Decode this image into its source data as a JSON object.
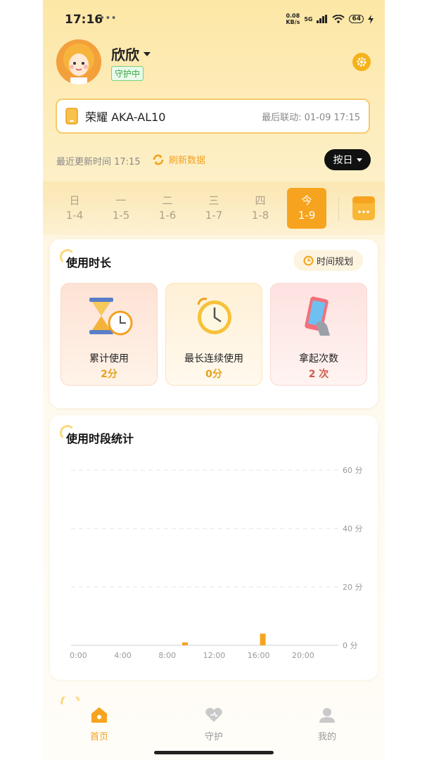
{
  "status_bar": {
    "time": "17:16",
    "extra": "•••",
    "net_speed_value": "0.08",
    "net_speed_unit": "KB/s",
    "network": "5G",
    "battery": "64"
  },
  "profile": {
    "name": "欣欣",
    "badge": "守护中",
    "settings_icon": "gear-icon"
  },
  "device": {
    "name": "荣耀 AKA-AL10",
    "last_sync": "最后联动: 01-09 17:15"
  },
  "update": {
    "text": "最近更新时间 17:15",
    "refresh_label": "刷新数据",
    "mode_label": "按日"
  },
  "days": [
    {
      "weekday": "日",
      "date": "1-4"
    },
    {
      "weekday": "一",
      "date": "1-5"
    },
    {
      "weekday": "二",
      "date": "1-6"
    },
    {
      "weekday": "三",
      "date": "1-7"
    },
    {
      "weekday": "四",
      "date": "1-8"
    },
    {
      "weekday": "今",
      "date": "1-9",
      "active": true
    }
  ],
  "usage": {
    "title": "使用时长",
    "plan_label": "时间规划",
    "tiles": [
      {
        "label": "累计使用",
        "value": "2分",
        "color": "#e3a21c"
      },
      {
        "label": "最长连续使用",
        "value": "0分",
        "color": "#e3a21c"
      },
      {
        "label": "拿起次数",
        "value": "2 次",
        "color": "#d25a4a"
      }
    ]
  },
  "chart_section": {
    "title": "使用时段统计"
  },
  "chart_data": {
    "type": "bar",
    "x_ticks": [
      "0:00",
      "4:00",
      "8:00",
      "12:00",
      "16:00",
      "20:00"
    ],
    "y_ticks": [
      "60 分",
      "40 分",
      "20 分",
      "0 分"
    ],
    "ylim": [
      0,
      60
    ],
    "bars": [
      {
        "hour": 10,
        "value": 1
      },
      {
        "hour": 17,
        "value": 4
      }
    ],
    "bar_color": "#f6a41f",
    "grid": true
  },
  "nav": {
    "items": [
      {
        "label": "首页",
        "active": true
      },
      {
        "label": "守护",
        "active": false
      },
      {
        "label": "我的",
        "active": false
      }
    ]
  },
  "colors": {
    "accent": "#f6a41f",
    "active_nav": "#f2a11e",
    "inactive_nav": "#999999"
  }
}
